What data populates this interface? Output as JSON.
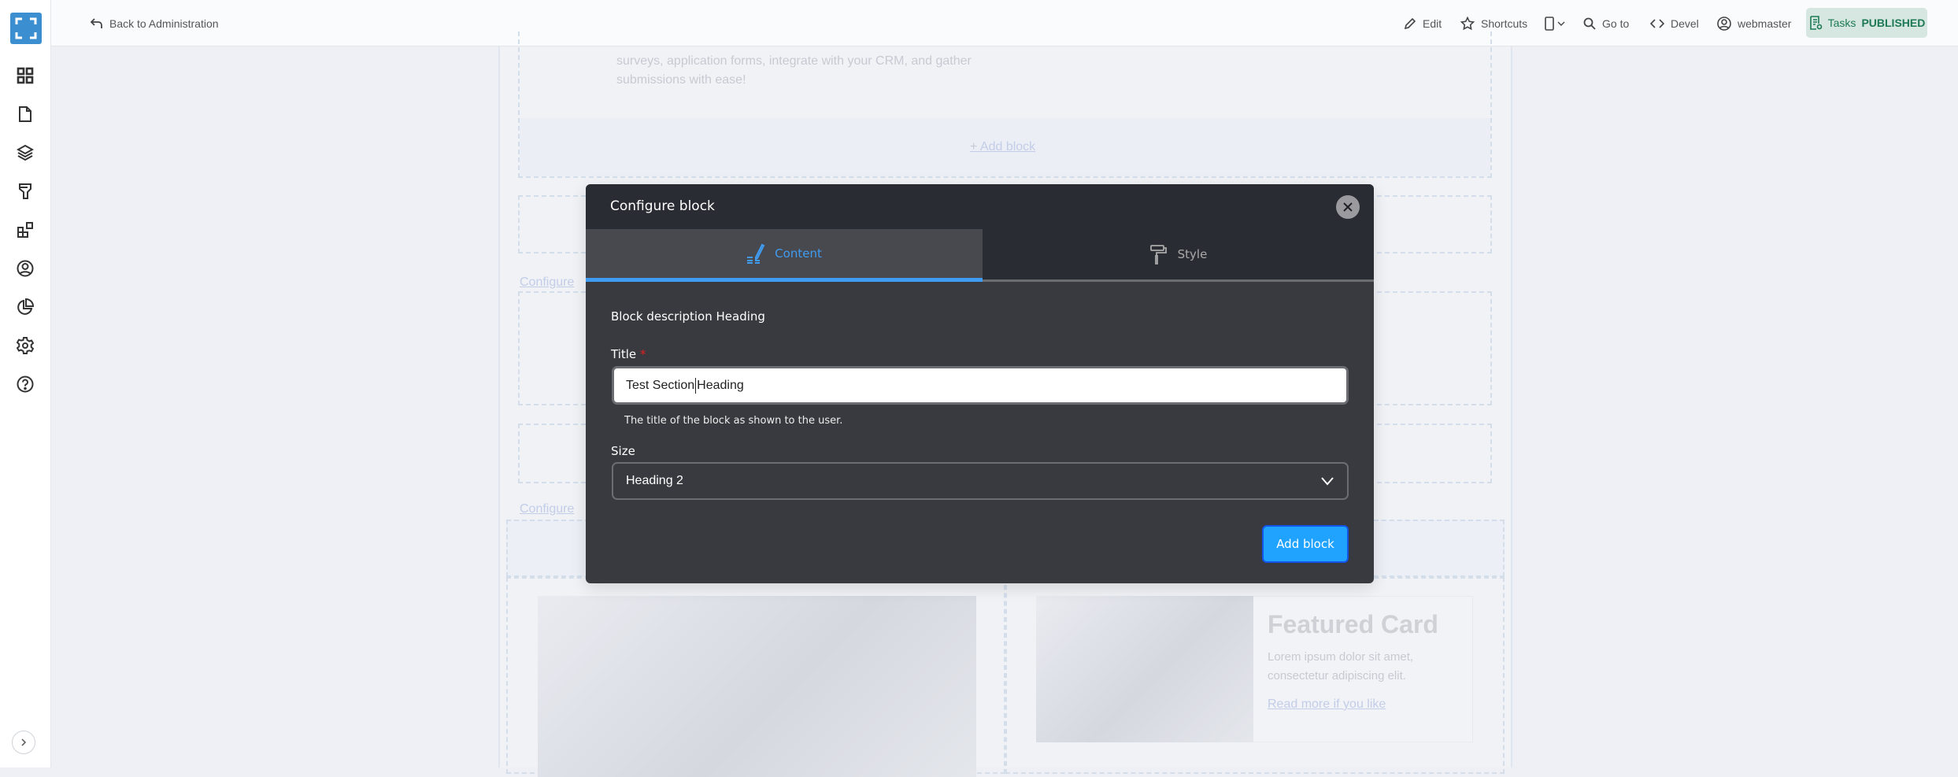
{
  "topbar": {
    "back_label": "Back to Administration",
    "edit": "Edit",
    "shortcuts": "Shortcuts",
    "goto": "Go to",
    "devel": "Devel",
    "user": "webmaster",
    "tasks": "Tasks",
    "status": "PUBLISHED"
  },
  "sidebar": {
    "items": [
      "dashboard-icon",
      "content-icon",
      "structure-icon",
      "appearance-icon",
      "extend-icon",
      "people-icon",
      "reports-icon",
      "config-icon",
      "help-icon"
    ]
  },
  "background": {
    "intro_line1": "surveys, application forms, integrate with your CRM, and gather",
    "intro_line2": "submissions with ease!",
    "add_block": "Add block",
    "configure1": "Configure",
    "configure2": "Configure",
    "card_title": "Featured Card",
    "card_text1": "Lorem ipsum dolor sit amet,",
    "card_text2": "consectetur adipiscing elit.",
    "card_link": "Read more if you like"
  },
  "modal": {
    "title": "Configure block",
    "tabs": [
      {
        "label": "Content",
        "active": true
      },
      {
        "label": "Style",
        "active": false
      }
    ],
    "description": "Block description Heading",
    "title_label": "Title",
    "required_mark": "*",
    "title_value_before": "Test Section",
    "title_value_after": "Heading",
    "title_help": "The title of the block as shown to the user.",
    "size_label": "Size",
    "size_value": "Heading 2",
    "submit": "Add block"
  },
  "colors": {
    "accent": "#3f9cf0",
    "button": "#20a3ff",
    "status": "#1d7a55"
  }
}
